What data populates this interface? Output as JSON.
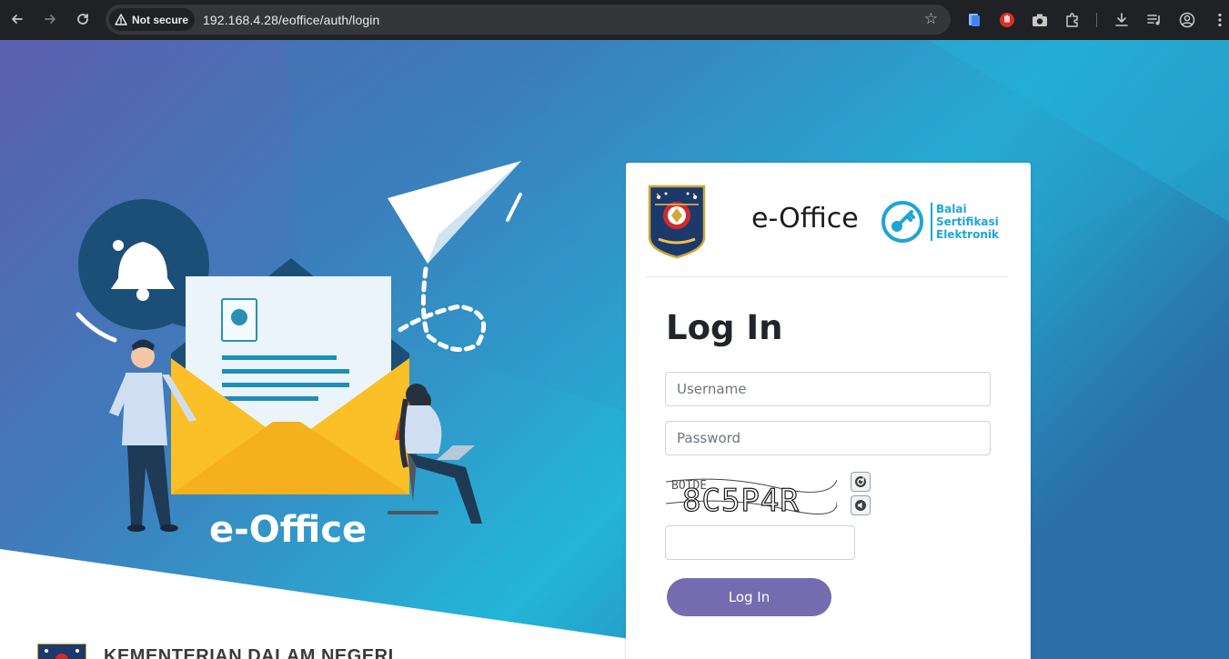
{
  "browser": {
    "security_label": "Not secure",
    "url": "192.168.4.28/eoffice/auth/login"
  },
  "hero": {
    "brand_text": "e-Office"
  },
  "card": {
    "app_name": "e-Office",
    "bse_lines": [
      "Balai",
      "Sertifikasi",
      "Elektronik"
    ],
    "title": "Log In",
    "username_placeholder": "Username",
    "password_placeholder": "Password",
    "captcha_text": "8C5P4R",
    "captcha_noise": "BOTDE",
    "captcha_input_value": "",
    "submit_label": "Log In"
  },
  "footer": {
    "ministry_name": "KEMENTERIAN DALAM NEGERI"
  },
  "colors": {
    "bg_gradient_left": "#5a62ad",
    "bg_gradient_right": "#1fb8d8",
    "button": "#756cb0",
    "bse_blue": "#1ea4d8"
  }
}
